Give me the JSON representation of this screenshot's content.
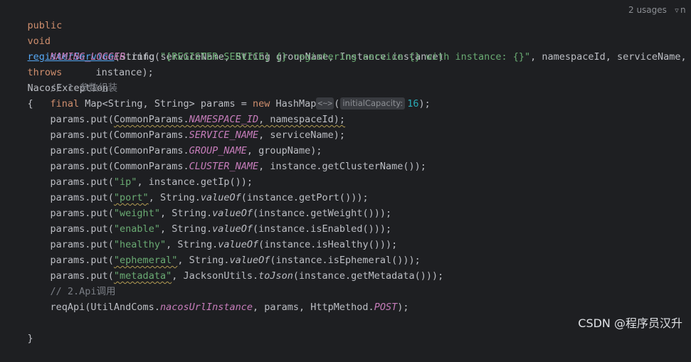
{
  "editor": {
    "language": "java",
    "signature": {
      "public_kw": "public",
      "void_kw": "void",
      "method_name": "registerService",
      "params": "(String serviceName, String groupName, Instance instance)",
      "throws_kw": "throws",
      "exception": "NacosException",
      "open_brace": "{"
    },
    "usages_hint": "2 usages",
    "author_hint": "n",
    "log_line": {
      "logger": "NAMING_LOGGER",
      "call": ".info(",
      "message": "\"[REGISTER-SERVICE] {} registering service {} with instance: {}\"",
      "args": ", namespaceId, serviceName,",
      "continuation": "instance);"
    },
    "comment_1": "// 1.参数组装",
    "map_decl": {
      "final_kw": "final",
      "type": " Map<String, String> params = ",
      "new_kw": "new",
      "ctor": " HashMap",
      "fold": "<~>",
      "open_paren": "(",
      "inlay_hint": "initialCapacity:",
      "capacity": "16",
      "close": ");"
    },
    "put_prefix": "params.put(",
    "puts": [
      {
        "klass": "CommonParams.",
        "const": "NAMESPACE_ID",
        "rest": ", namespaceId);"
      },
      {
        "klass": "CommonParams.",
        "const": "SERVICE_NAME",
        "rest": ", serviceName);"
      },
      {
        "klass": "CommonParams.",
        "const": "GROUP_NAME",
        "rest": ", groupName);"
      },
      {
        "klass": "CommonParams.",
        "const": "CLUSTER_NAME",
        "rest": ", instance.getClusterName());"
      }
    ],
    "string_puts": [
      {
        "key": "\"ip\"",
        "mid": ", instance.getIp());",
        "static_call": "",
        "tail": ""
      },
      {
        "key": "\"port\"",
        "mid": ", String.",
        "static_call": "valueOf",
        "tail": "(instance.getPort()));"
      },
      {
        "key": "\"weight\"",
        "mid": ", String.",
        "static_call": "valueOf",
        "tail": "(instance.getWeight()));"
      },
      {
        "key": "\"enable\"",
        "mid": ", String.",
        "static_call": "valueOf",
        "tail": "(instance.isEnabled()));"
      },
      {
        "key": "\"healthy\"",
        "mid": ", String.",
        "static_call": "valueOf",
        "tail": "(instance.isHealthy()));"
      },
      {
        "key": "\"ephemeral\"",
        "mid": ", String.",
        "static_call": "valueOf",
        "tail": "(instance.isEphemeral()));"
      },
      {
        "key": "\"metadata\"",
        "mid": ", JacksonUtils.",
        "static_call": "toJson",
        "tail": "(instance.getMetadata()));"
      }
    ],
    "comment_2": "// 2.Api调用",
    "req_line": {
      "call": "reqApi(UtilAndComs.",
      "static_field": "nacosUrlInstance",
      "mid": ", params, HttpMethod.",
      "method_const": "POST",
      "close": ");"
    },
    "close_brace": "}"
  },
  "watermark": "CSDN @程序员汉升",
  "colors": {
    "background": "#1e1f22",
    "keyword": "#cf8e6d",
    "method": "#56a8f5",
    "constant": "#c77dbb",
    "string": "#6aab73",
    "number": "#2aacb8",
    "comment": "#7a7e85",
    "text": "#bcbec4"
  }
}
